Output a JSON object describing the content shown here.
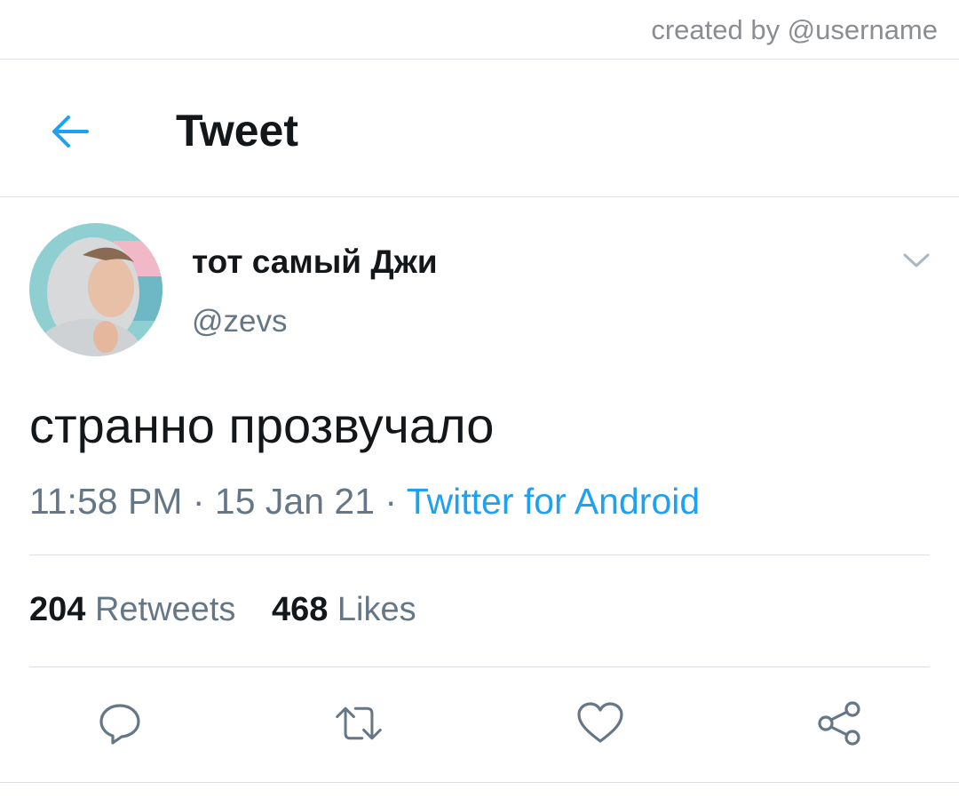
{
  "watermark": "created by @username",
  "header": {
    "title": "Tweet",
    "back_icon": "arrow-left-icon"
  },
  "tweet": {
    "author_name": "тот самый Джи",
    "author_handle": "@zevs",
    "text": "странно прозвучало",
    "time": "11:58 PM",
    "date": "15 Jan 21",
    "source": "Twitter for Android",
    "retweets": "204",
    "retweets_label": "Retweets",
    "likes": "468",
    "likes_label": "Likes"
  },
  "actions": [
    "reply-icon",
    "retweet-icon",
    "like-icon",
    "share-icon"
  ],
  "colors": {
    "accent": "#1da1f2",
    "secondary_text": "#657786",
    "primary_text": "#14171a",
    "divider": "#dcdfe3"
  }
}
